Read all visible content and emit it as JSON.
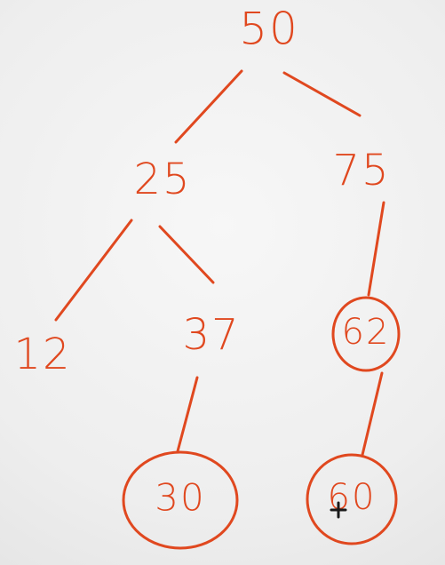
{
  "tree": {
    "stroke_color": "#e0481f",
    "background_color": "#f1f1f1",
    "nodes": [
      {
        "id": "n50",
        "label": "50",
        "circled": false
      },
      {
        "id": "n25",
        "label": "25",
        "circled": false
      },
      {
        "id": "n75",
        "label": "75",
        "circled": false
      },
      {
        "id": "n12",
        "label": "12",
        "circled": false
      },
      {
        "id": "n37",
        "label": "37",
        "circled": false
      },
      {
        "id": "n62",
        "label": "62",
        "circled": true
      },
      {
        "id": "n30",
        "label": "30",
        "circled": true
      },
      {
        "id": "n60",
        "label": "60",
        "circled": true
      }
    ],
    "edges": [
      {
        "from": "n50",
        "to": "n25"
      },
      {
        "from": "n50",
        "to": "n75"
      },
      {
        "from": "n25",
        "to": "n12"
      },
      {
        "from": "n25",
        "to": "n37"
      },
      {
        "from": "n75",
        "to": "n62"
      },
      {
        "from": "n37",
        "to": "n30"
      },
      {
        "from": "n62",
        "to": "n60"
      }
    ]
  }
}
